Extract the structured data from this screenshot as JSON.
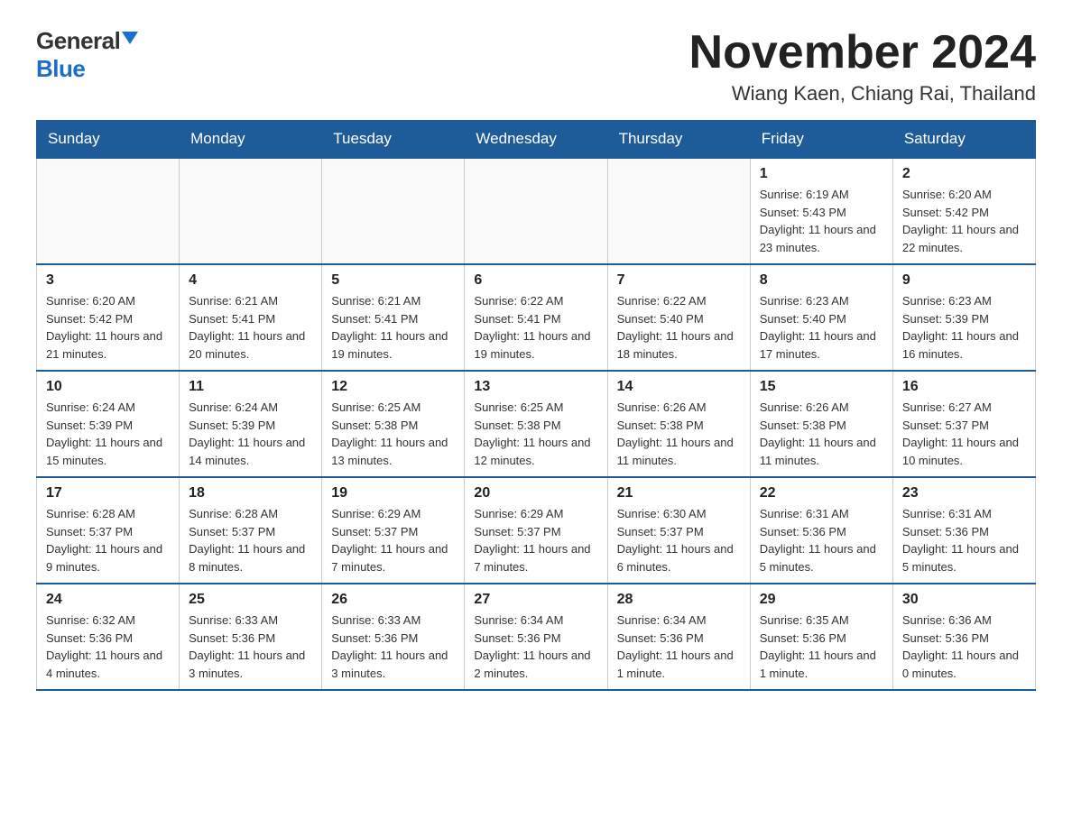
{
  "logo": {
    "general": "General",
    "blue": "Blue"
  },
  "title": "November 2024",
  "subtitle": "Wiang Kaen, Chiang Rai, Thailand",
  "days_of_week": [
    "Sunday",
    "Monday",
    "Tuesday",
    "Wednesday",
    "Thursday",
    "Friday",
    "Saturday"
  ],
  "weeks": [
    [
      {
        "day": "",
        "info": ""
      },
      {
        "day": "",
        "info": ""
      },
      {
        "day": "",
        "info": ""
      },
      {
        "day": "",
        "info": ""
      },
      {
        "day": "",
        "info": ""
      },
      {
        "day": "1",
        "info": "Sunrise: 6:19 AM\nSunset: 5:43 PM\nDaylight: 11 hours and 23 minutes."
      },
      {
        "day": "2",
        "info": "Sunrise: 6:20 AM\nSunset: 5:42 PM\nDaylight: 11 hours and 22 minutes."
      }
    ],
    [
      {
        "day": "3",
        "info": "Sunrise: 6:20 AM\nSunset: 5:42 PM\nDaylight: 11 hours and 21 minutes."
      },
      {
        "day": "4",
        "info": "Sunrise: 6:21 AM\nSunset: 5:41 PM\nDaylight: 11 hours and 20 minutes."
      },
      {
        "day": "5",
        "info": "Sunrise: 6:21 AM\nSunset: 5:41 PM\nDaylight: 11 hours and 19 minutes."
      },
      {
        "day": "6",
        "info": "Sunrise: 6:22 AM\nSunset: 5:41 PM\nDaylight: 11 hours and 19 minutes."
      },
      {
        "day": "7",
        "info": "Sunrise: 6:22 AM\nSunset: 5:40 PM\nDaylight: 11 hours and 18 minutes."
      },
      {
        "day": "8",
        "info": "Sunrise: 6:23 AM\nSunset: 5:40 PM\nDaylight: 11 hours and 17 minutes."
      },
      {
        "day": "9",
        "info": "Sunrise: 6:23 AM\nSunset: 5:39 PM\nDaylight: 11 hours and 16 minutes."
      }
    ],
    [
      {
        "day": "10",
        "info": "Sunrise: 6:24 AM\nSunset: 5:39 PM\nDaylight: 11 hours and 15 minutes."
      },
      {
        "day": "11",
        "info": "Sunrise: 6:24 AM\nSunset: 5:39 PM\nDaylight: 11 hours and 14 minutes."
      },
      {
        "day": "12",
        "info": "Sunrise: 6:25 AM\nSunset: 5:38 PM\nDaylight: 11 hours and 13 minutes."
      },
      {
        "day": "13",
        "info": "Sunrise: 6:25 AM\nSunset: 5:38 PM\nDaylight: 11 hours and 12 minutes."
      },
      {
        "day": "14",
        "info": "Sunrise: 6:26 AM\nSunset: 5:38 PM\nDaylight: 11 hours and 11 minutes."
      },
      {
        "day": "15",
        "info": "Sunrise: 6:26 AM\nSunset: 5:38 PM\nDaylight: 11 hours and 11 minutes."
      },
      {
        "day": "16",
        "info": "Sunrise: 6:27 AM\nSunset: 5:37 PM\nDaylight: 11 hours and 10 minutes."
      }
    ],
    [
      {
        "day": "17",
        "info": "Sunrise: 6:28 AM\nSunset: 5:37 PM\nDaylight: 11 hours and 9 minutes."
      },
      {
        "day": "18",
        "info": "Sunrise: 6:28 AM\nSunset: 5:37 PM\nDaylight: 11 hours and 8 minutes."
      },
      {
        "day": "19",
        "info": "Sunrise: 6:29 AM\nSunset: 5:37 PM\nDaylight: 11 hours and 7 minutes."
      },
      {
        "day": "20",
        "info": "Sunrise: 6:29 AM\nSunset: 5:37 PM\nDaylight: 11 hours and 7 minutes."
      },
      {
        "day": "21",
        "info": "Sunrise: 6:30 AM\nSunset: 5:37 PM\nDaylight: 11 hours and 6 minutes."
      },
      {
        "day": "22",
        "info": "Sunrise: 6:31 AM\nSunset: 5:36 PM\nDaylight: 11 hours and 5 minutes."
      },
      {
        "day": "23",
        "info": "Sunrise: 6:31 AM\nSunset: 5:36 PM\nDaylight: 11 hours and 5 minutes."
      }
    ],
    [
      {
        "day": "24",
        "info": "Sunrise: 6:32 AM\nSunset: 5:36 PM\nDaylight: 11 hours and 4 minutes."
      },
      {
        "day": "25",
        "info": "Sunrise: 6:33 AM\nSunset: 5:36 PM\nDaylight: 11 hours and 3 minutes."
      },
      {
        "day": "26",
        "info": "Sunrise: 6:33 AM\nSunset: 5:36 PM\nDaylight: 11 hours and 3 minutes."
      },
      {
        "day": "27",
        "info": "Sunrise: 6:34 AM\nSunset: 5:36 PM\nDaylight: 11 hours and 2 minutes."
      },
      {
        "day": "28",
        "info": "Sunrise: 6:34 AM\nSunset: 5:36 PM\nDaylight: 11 hours and 1 minute."
      },
      {
        "day": "29",
        "info": "Sunrise: 6:35 AM\nSunset: 5:36 PM\nDaylight: 11 hours and 1 minute."
      },
      {
        "day": "30",
        "info": "Sunrise: 6:36 AM\nSunset: 5:36 PM\nDaylight: 11 hours and 0 minutes."
      }
    ]
  ]
}
